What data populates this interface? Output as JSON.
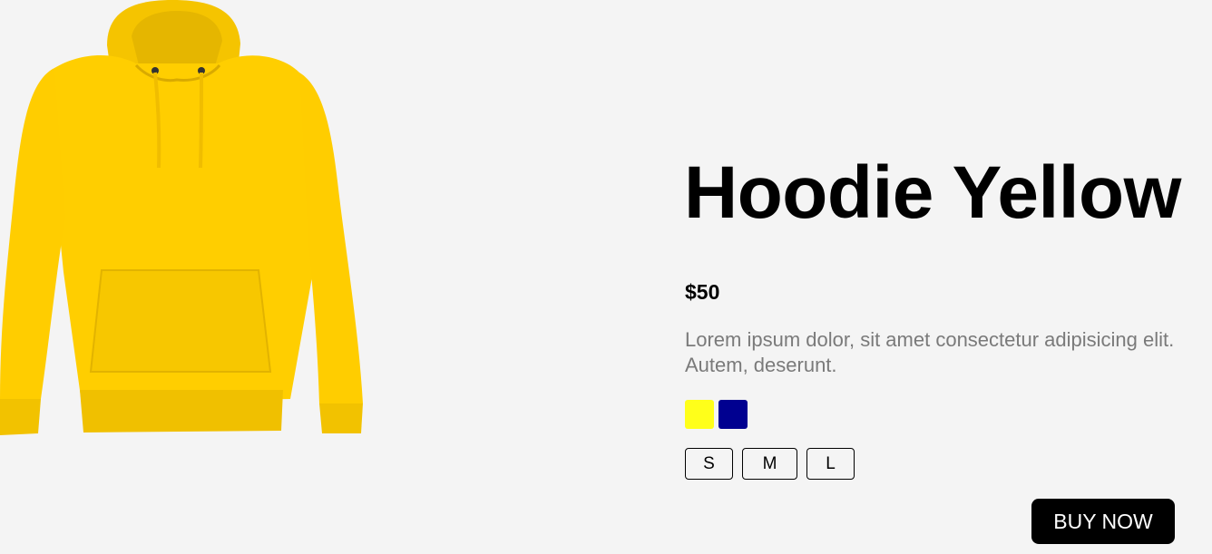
{
  "product": {
    "image_icon": "hoodie-image",
    "title": "Hoodie Yellow",
    "price": "$50",
    "description": "Lorem ipsum dolor, sit amet consectetur adipisicing elit. Autem, deserunt.",
    "colors": [
      {
        "name": "yellow",
        "hex": "#ffff1a"
      },
      {
        "name": "navy",
        "hex": "#000090"
      }
    ],
    "sizes": [
      "S",
      "M",
      "L"
    ],
    "buy_label": "BUY NOW"
  }
}
